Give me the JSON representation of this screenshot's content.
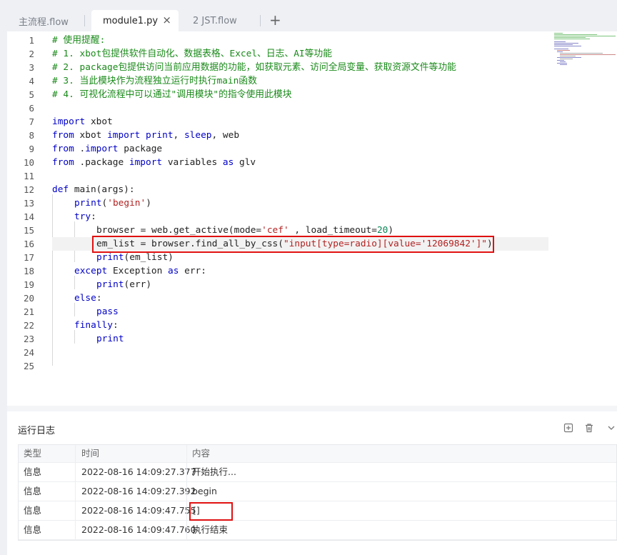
{
  "tabs": [
    {
      "label": "主流程.flow",
      "active": false
    },
    {
      "label": "module1.py",
      "active": true
    },
    {
      "label": "2 JST.flow",
      "active": false
    }
  ],
  "tab_close": "×",
  "tab_add": "+",
  "editor": {
    "lines": [
      {
        "n": "1"
      },
      {
        "n": "2"
      },
      {
        "n": "3"
      },
      {
        "n": "4"
      },
      {
        "n": "5"
      },
      {
        "n": "6"
      },
      {
        "n": "7"
      },
      {
        "n": "8"
      },
      {
        "n": "9"
      },
      {
        "n": "10"
      },
      {
        "n": "11"
      },
      {
        "n": "12"
      },
      {
        "n": "13"
      },
      {
        "n": "14"
      },
      {
        "n": "15"
      },
      {
        "n": "16"
      },
      {
        "n": "17"
      },
      {
        "n": "18"
      },
      {
        "n": "19"
      },
      {
        "n": "20"
      },
      {
        "n": "21"
      },
      {
        "n": "22"
      },
      {
        "n": "23"
      },
      {
        "n": "24"
      },
      {
        "n": "25"
      }
    ],
    "code": {
      "c1": "# 使用提醒:",
      "c2": "# 1. xbot包提供软件自动化、数据表格、Excel、日志、AI等功能",
      "c3": "# 2. package包提供访问当前应用数据的功能，如获取元素、访问全局变量、获取资源文件等功能",
      "c4": "# 3. 当此模块作为流程独立运行时执行main函数",
      "c5": "# 4. 可视化流程中可以通过\"调用模块\"的指令使用此模块",
      "import": "import",
      "from": "from",
      "as": "as",
      "def": "def",
      "try": "try",
      "except": "except",
      "else": "else",
      "finally": "finally",
      "print": "print",
      "sleep": "sleep",
      "pass": "pass",
      "xbot": " xbot",
      "l8_mid": " xbot ",
      "l8_tail": ", web",
      "l8_comma": ", ",
      "l9_mid": " .",
      "l9_tail": " package",
      "l10_mid": " .package ",
      "l10_tail": " variables ",
      "l10_glv": " glv",
      "l12_tail": " main(args):",
      "l13_open": "(",
      "l13_str": "'begin'",
      "l13_close": ")",
      "colon": ":",
      "l15_a": "browser = web.get_active(mode=",
      "l15_str": "'cef'",
      "l15_b": " , load_timeout=",
      "l15_num": "20",
      "l15_c": ")",
      "l16_a": "em_list = browser.find_all_by_css(",
      "l16_str": "\"input[type=radio][value='12069842']\"",
      "l16_c": ")",
      "l17_tail": "(em_list)",
      "l18_mid": " Exception ",
      "l18_tail": " err:",
      "l19_tail": "(err)"
    }
  },
  "log_panel": {
    "title": "运行日志",
    "icons": [
      "export-icon",
      "trash-icon",
      "chevron-down-icon"
    ],
    "columns": [
      "类型",
      "时间",
      "内容"
    ],
    "rows": [
      {
        "type": "信息",
        "time": "2022-08-16 14:09:27.377",
        "content": "开始执行..."
      },
      {
        "type": "信息",
        "time": "2022-08-16 14:09:27.392",
        "content": "begin"
      },
      {
        "type": "信息",
        "time": "2022-08-16 14:09:47.755",
        "content": "[]"
      },
      {
        "type": "信息",
        "time": "2022-08-16 14:09:47.760",
        "content": "执行结束"
      }
    ]
  },
  "colors": {
    "highlight_box": "#e01010",
    "comment": "#1a8a1a",
    "keyword": "#0000c8",
    "string": "#b22222"
  }
}
